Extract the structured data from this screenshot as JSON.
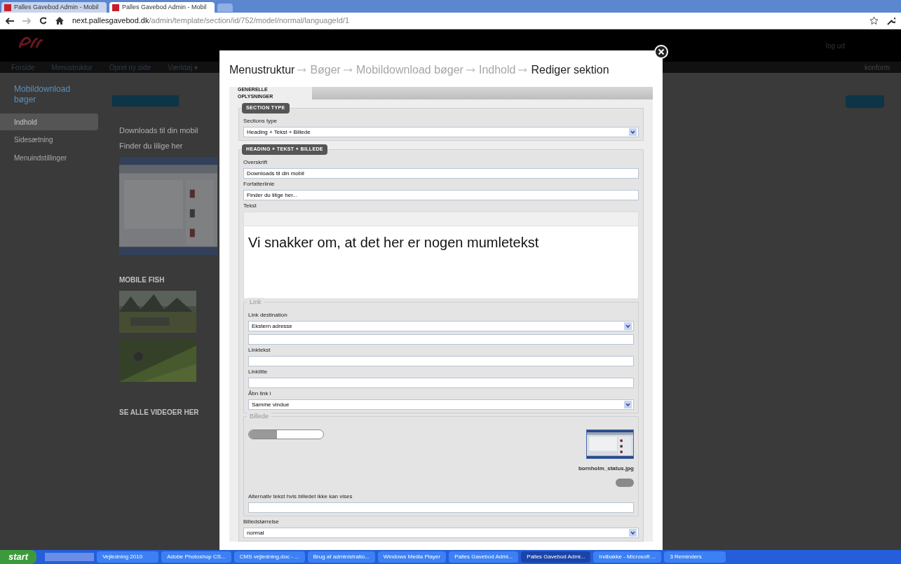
{
  "browser": {
    "tabs": [
      {
        "label": "Palles Gavebod Admin - Mobil",
        "selected": false
      },
      {
        "label": "Palles Gavebod Admin - Mobil",
        "selected": true
      }
    ],
    "url_host": "next.pallesgavebod.dk",
    "url_path": "/admin/template/section/id/752/model/normal/languageId/1"
  },
  "site": {
    "nav": [
      "Forside",
      "Menustruktur",
      "Opret ny side",
      "Værktøj ▾"
    ],
    "header_link": "log ud",
    "right_nav": "konform",
    "sidebar": {
      "title": "Mobildownload bøger",
      "items": [
        {
          "label": "Indhold",
          "selected": true
        },
        {
          "label": "Sidesætning",
          "selected": false
        },
        {
          "label": "Menuindstillinger",
          "selected": false
        }
      ]
    },
    "sections": [
      {
        "kind": "text",
        "lines": [
          "Downloads til din mobil",
          "Finder du lilige her"
        ]
      },
      {
        "kind": "videos",
        "title": "MOBILE FISH"
      },
      {
        "kind": "title",
        "title": "SE ALLE VIDEOER HER"
      }
    ]
  },
  "modal": {
    "breadcrumb": [
      {
        "label": "Menustruktur",
        "dimmed": false
      },
      {
        "label": "Bøger",
        "dimmed": true
      },
      {
        "label": "Mobildownload bøger",
        "dimmed": true
      },
      {
        "label": "Indhold",
        "dimmed": true
      },
      {
        "label": "Rediger sektion",
        "dimmed": false
      }
    ],
    "tabs": [
      {
        "label": "GENERELLE OPLYSNINGER",
        "selected": true
      }
    ],
    "section_type": {
      "legend": "SECTION TYPE",
      "label": "Sections type",
      "value": "Heading + Tekst + Billede"
    },
    "content": {
      "legend": "HEADING + TEKST + BILLEDE",
      "fields": [
        {
          "label": "Overskrift",
          "value": "Downloads til din mobil"
        },
        {
          "label": "Forfatterlinie",
          "value": "Finder du lilige her..."
        }
      ],
      "text_label": "Tekst",
      "text": "Vi snakker om, at det her er nogen mumletekst"
    },
    "link": {
      "legend": "Link",
      "fields": [
        {
          "kind": "select",
          "label": "Link destination",
          "value": "Ekstern adresse"
        },
        {
          "kind": "input"
        },
        {
          "kind": "input",
          "label": "Linktekst"
        },
        {
          "kind": "input",
          "label": "Linktitle"
        },
        {
          "kind": "select",
          "label": "Åbn link i",
          "value": "Samme vindue"
        }
      ]
    },
    "image": {
      "legend": "Billede",
      "filename": "bornholm_status.jpg",
      "alt_label": "Alternativ tekst hvis billedet ikke kan vises"
    },
    "size": {
      "label": "Billedstørrelse",
      "value": "normal"
    }
  },
  "taskbar": {
    "start": "start",
    "items": [
      {
        "label": "Vejledning 2010",
        "selected": false
      },
      {
        "label": "Adobe Photoshop CS...",
        "selected": false
      },
      {
        "label": "CMS vejledning.doc - ...",
        "selected": false
      },
      {
        "label": "Brug af administratio...",
        "selected": false
      },
      {
        "label": "Windows Media Player",
        "selected": false
      },
      {
        "label": "Palles Gavebod Admi...",
        "selected": false
      },
      {
        "label": "Palles Gavebod Admi...",
        "selected": true
      },
      {
        "label": "Indbakke - Microsoft ...",
        "selected": false
      },
      {
        "label": "3 Reminders",
        "selected": false
      }
    ]
  }
}
